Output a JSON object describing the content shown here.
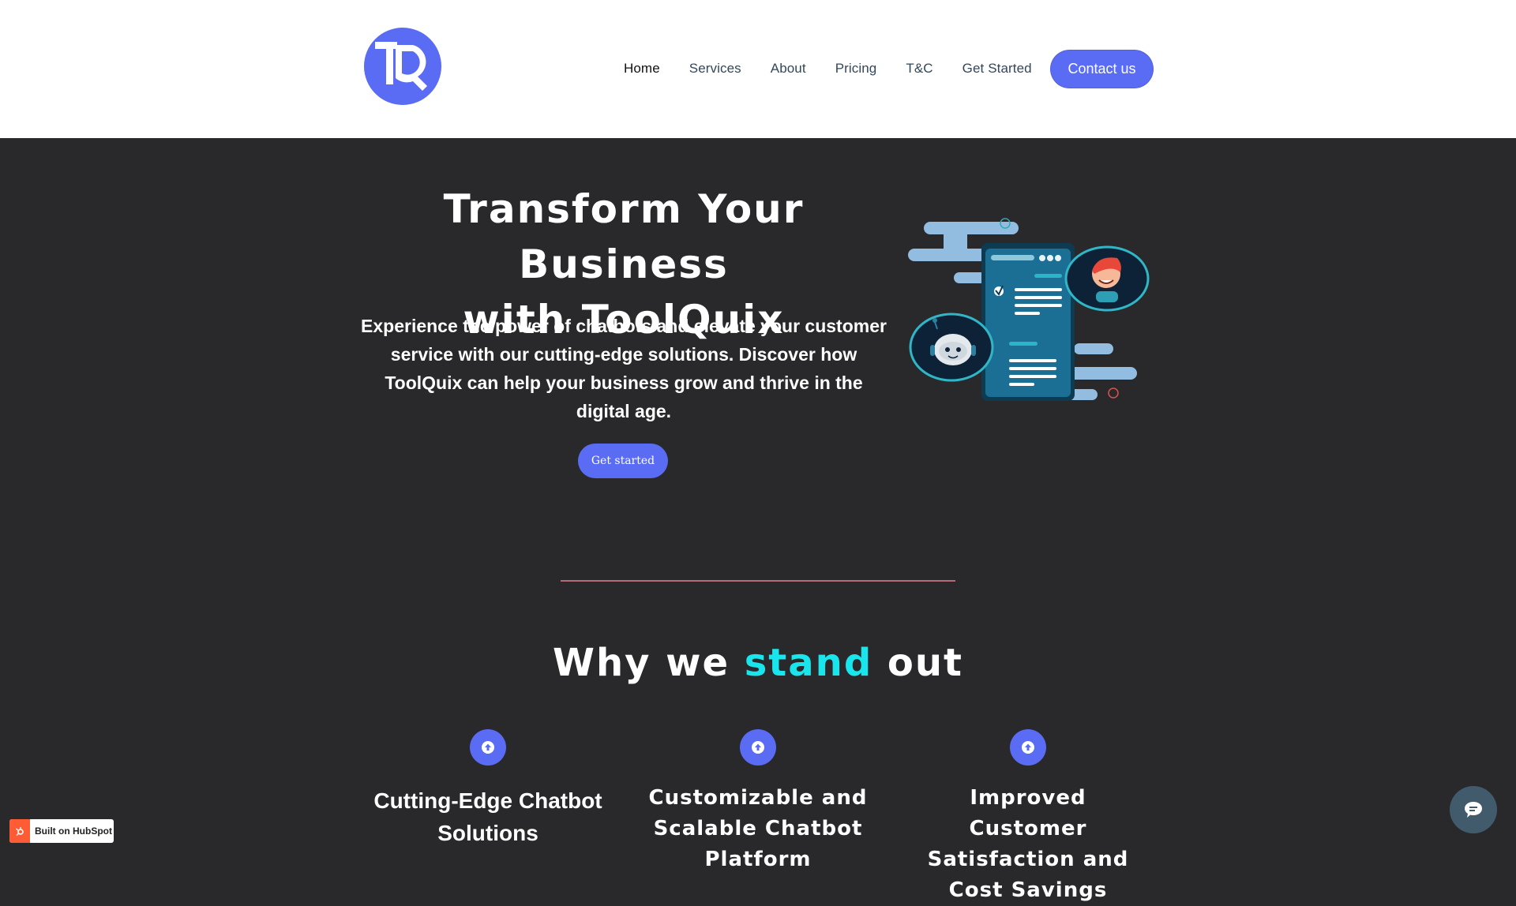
{
  "brand": {
    "name": "ToolQuix",
    "logo_icon": "tq-logo-icon",
    "primary_color": "#5a6cf3",
    "accent_color": "#19e6ec"
  },
  "header": {
    "nav": [
      {
        "label": "Home",
        "active": true
      },
      {
        "label": "Services",
        "active": false
      },
      {
        "label": "About",
        "active": false
      },
      {
        "label": "Pricing",
        "active": false
      },
      {
        "label": "T&C",
        "active": false
      },
      {
        "label": "Get Started",
        "active": false
      }
    ],
    "contact_label": "Contact us"
  },
  "hero": {
    "title_line1": "Transform Your Business",
    "title_line2": "with ToolQuix",
    "description": "Experience the power of chatbots and elevate your customer service with our cutting-edge solutions. Discover how ToolQuix can help your business grow and thrive in the digital age.",
    "cta_label": "Get started",
    "illustration": "chatbot-conversation-illustration"
  },
  "why": {
    "title_before": "Why we ",
    "title_accent": "stand",
    "title_after": " out",
    "features": [
      {
        "title": "Cutting-Edge Chatbot Solutions",
        "icon": "arrow-up-circle-icon"
      },
      {
        "title": "Customizable and Scalable Chatbot Platform",
        "icon": "arrow-up-circle-icon"
      },
      {
        "title": "Improved Customer Satisfaction and Cost Savings",
        "icon": "arrow-up-circle-icon"
      }
    ]
  },
  "badges": {
    "hubspot_label": "Built on HubSpot",
    "chat_icon": "chat-bubble-icon"
  }
}
